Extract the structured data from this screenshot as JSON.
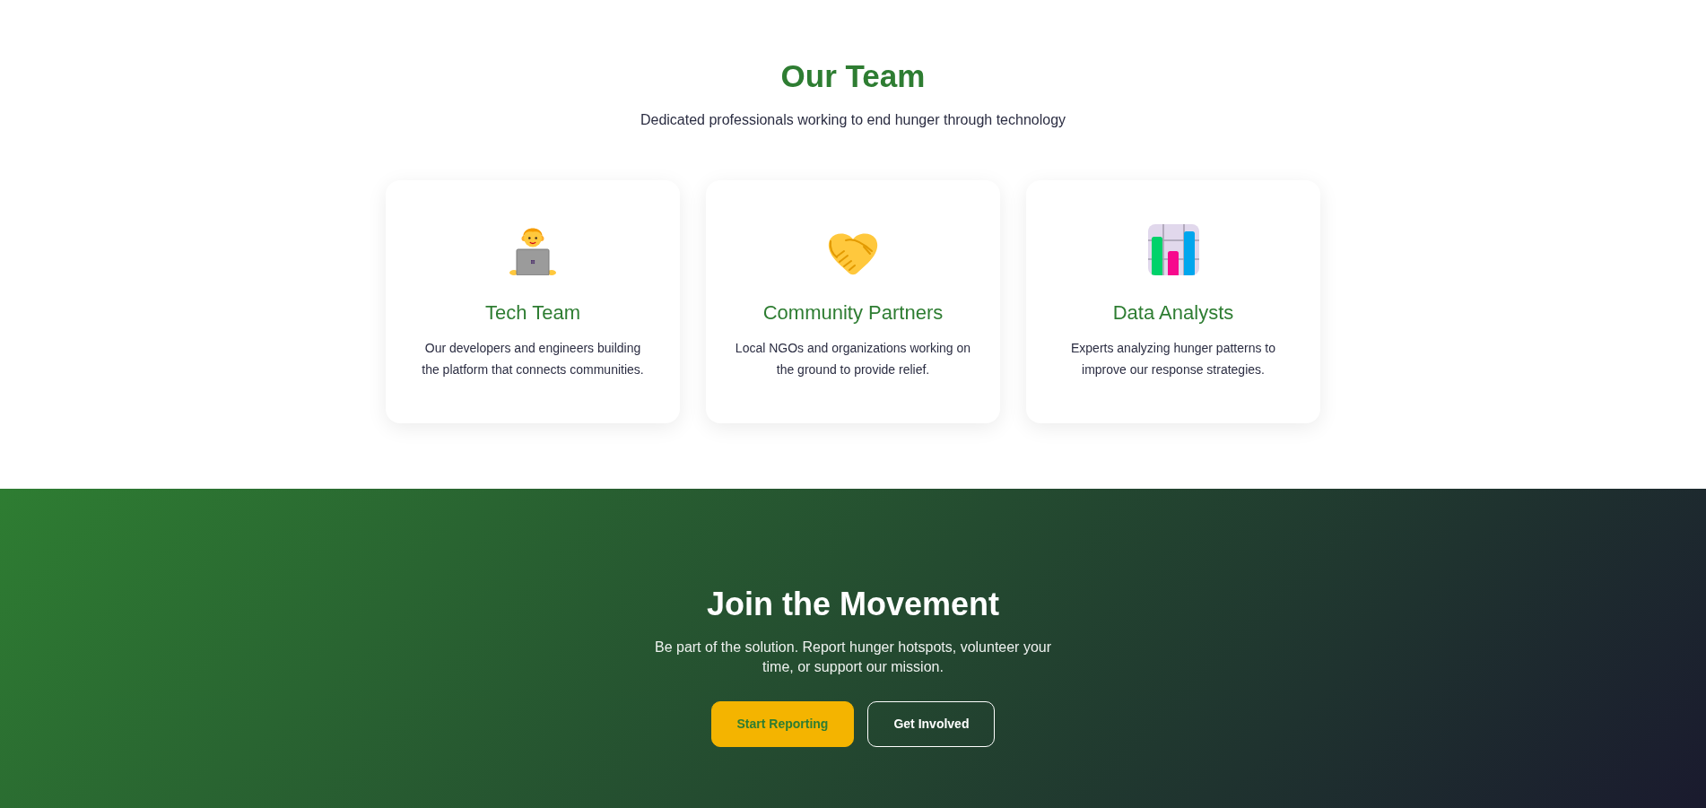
{
  "header": {
    "title": "Our Team",
    "subtitle": "Dedicated professionals working to end hunger through technology"
  },
  "team_cards": [
    {
      "kind": "developer",
      "title": "Tech Team",
      "description": "Our developers and engineers building the platform that connects communities."
    },
    {
      "kind": "partner",
      "title": "Community Partners",
      "description": "Local NGOs and organizations working on the ground to provide relief."
    },
    {
      "kind": "analyst",
      "title": "Data Analysts",
      "description": "Experts analyzing hunger patterns to improve our response strategies."
    }
  ],
  "cta": {
    "title": "Join the Movement",
    "text": "Be part of the solution. Report hunger hotspots, volunteer your time, or support our mission.",
    "buttons": [
      {
        "label": "Start Reporting",
        "kind": "primary"
      },
      {
        "label": "Get Involved",
        "kind": "outline"
      }
    ]
  }
}
